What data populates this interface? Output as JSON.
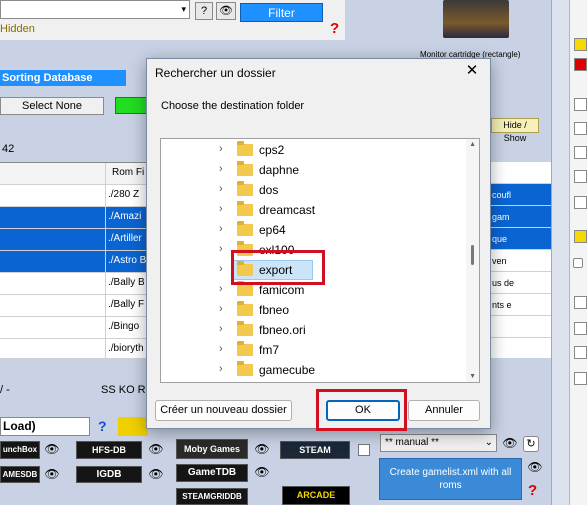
{
  "app": {
    "top_combo_value": "",
    "help_button": "?",
    "filter_button": "Filter",
    "hidden_label": "Hidden",
    "help_mark": "?",
    "monitor_label": "Monitor cartridge (rectangle)",
    "sorting_label": "Sorting Database",
    "select_none": "Select None",
    "hide_show": "Hide / Show",
    "count": "42",
    "column_header_rom": "Rom Fi",
    "rows": [
      {
        "rom": "./280 Z",
        "selected": false
      },
      {
        "rom": "./Amazi",
        "selected": true
      },
      {
        "rom": "./Artiller",
        "selected": true
      },
      {
        "rom": "./Astro B",
        "selected": true
      },
      {
        "rom": "./Bally B",
        "selected": false
      },
      {
        "rom": "./Bally F",
        "selected": false
      },
      {
        "rom": "./Bingo",
        "selected": false
      },
      {
        "rom": "./bioryth",
        "selected": false
      }
    ],
    "right_rows": [
      {
        "text": "",
        "selected": false
      },
      {
        "text": "coufl",
        "selected": true
      },
      {
        "text": "gam",
        "selected": true
      },
      {
        "text": "que",
        "selected": true
      },
      {
        "text": "ven",
        "selected": false
      },
      {
        "text": "us de",
        "selected": false
      },
      {
        "text": "nts e",
        "selected": false
      },
      {
        "text": "",
        "selected": false
      }
    ],
    "status_left": "/ -",
    "status_ssko": "SS KO Re",
    "load_label": "Load)",
    "help_blue": "?",
    "manual_combo": "** manual **",
    "gamelist_button": "Create gamelist.xml with all roms",
    "logos": {
      "launchbox": "unchBox",
      "hfsdb": "HFS-DB",
      "moby": "Moby Games",
      "steam": "STEAM",
      "gamesdb": "AMESDB",
      "igdb": "IGDB",
      "gametdb": "GameTDB",
      "steamgriddb": "STEAMGRIDDB",
      "arcade": "ARCADE"
    }
  },
  "dialog": {
    "title": "Rechercher un dossier",
    "close": "✕",
    "subtitle": "Choose the destination folder",
    "folders": [
      {
        "name": "cps2",
        "selected": false
      },
      {
        "name": "daphne",
        "selected": false
      },
      {
        "name": "dos",
        "selected": false
      },
      {
        "name": "dreamcast",
        "selected": false
      },
      {
        "name": "ep64",
        "selected": false
      },
      {
        "name": "exl100",
        "selected": false
      },
      {
        "name": "export",
        "selected": true
      },
      {
        "name": "famicom",
        "selected": false
      },
      {
        "name": "fbneo",
        "selected": false
      },
      {
        "name": "fbneo.ori",
        "selected": false
      },
      {
        "name": "fm7",
        "selected": false
      },
      {
        "name": "gamecube",
        "selected": false
      }
    ],
    "new_folder_button": "Créer un nouveau dossier",
    "ok_button": "OK",
    "cancel_button": "Annuler"
  },
  "colors": {
    "accent": "#1e90ff",
    "highlight_box": "#d01020",
    "selection": "#0a64d2"
  }
}
